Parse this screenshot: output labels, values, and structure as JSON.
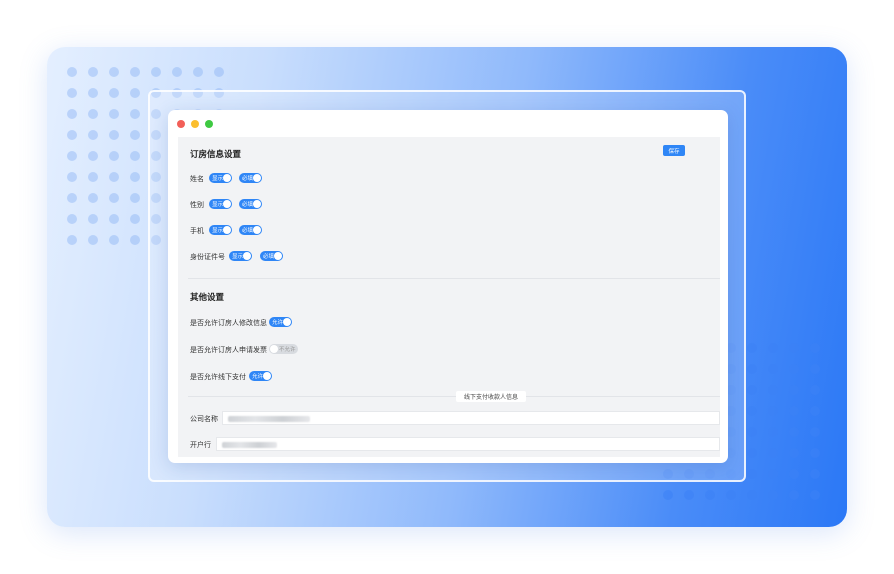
{
  "window": {
    "traffic_lights": [
      "close",
      "minimize",
      "maximize"
    ]
  },
  "booking_section": {
    "title": "订房信息设置",
    "save_label": "保存",
    "rows": [
      {
        "label": "姓名",
        "show": "显示",
        "required": "必填"
      },
      {
        "label": "性别",
        "show": "显示",
        "required": "必填"
      },
      {
        "label": "手机",
        "show": "显示",
        "required": "必填"
      },
      {
        "label": "身份证件号",
        "show": "显示",
        "required": "必填"
      }
    ]
  },
  "other_section": {
    "title": "其他设置",
    "rows": [
      {
        "label": "是否允许订房人修改信息",
        "toggle": "允许",
        "on": true
      },
      {
        "label": "是否允许订房人申请发票",
        "toggle": "不允许",
        "on": false
      },
      {
        "label": "是否允许线下支付",
        "toggle": "允许",
        "on": true
      }
    ]
  },
  "offline_payment": {
    "header": "线下支付收款人信息",
    "fields": [
      {
        "label": "公司名称"
      },
      {
        "label": "开户行"
      }
    ]
  },
  "colors": {
    "accent": "#2f86f6",
    "toggle_off": "#d8dbe0",
    "panel_bg": "#f2f3f5"
  }
}
